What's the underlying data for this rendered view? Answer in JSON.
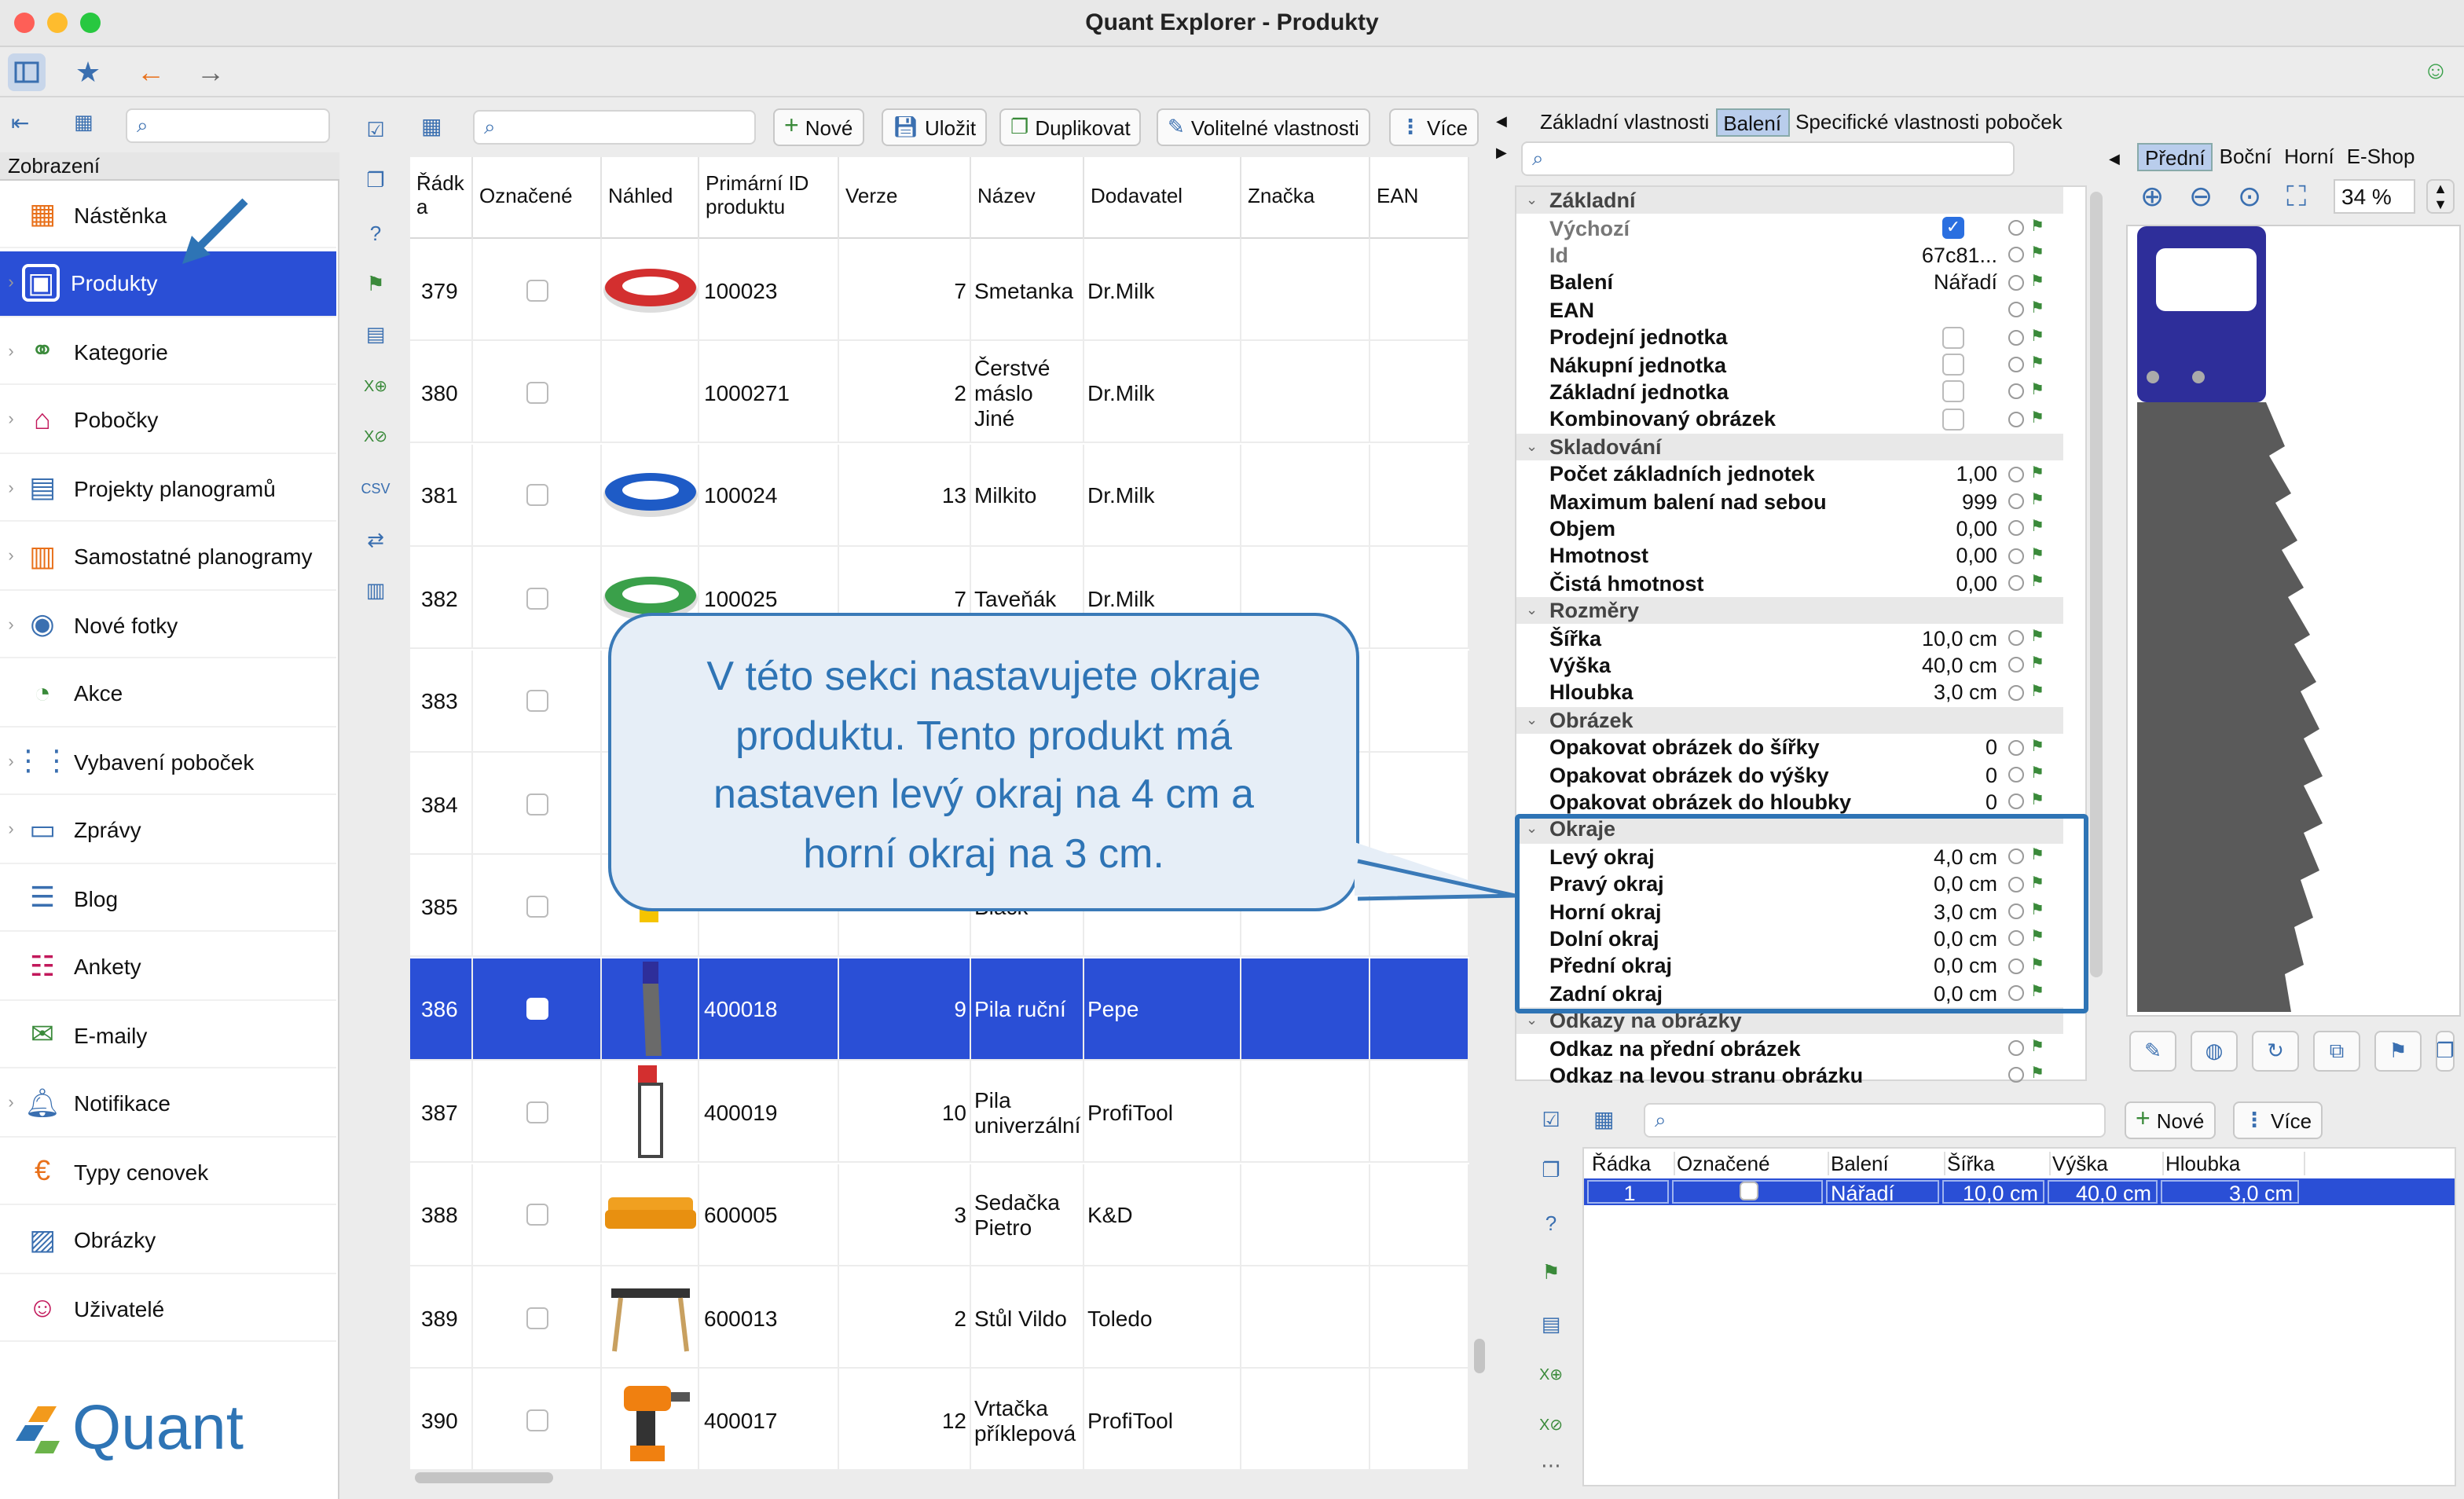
{
  "window": {
    "title": "Quant Explorer - Produkty"
  },
  "sidebar": {
    "section": "Zobrazení",
    "items": [
      {
        "label": "Nástěnka"
      },
      {
        "label": "Produkty"
      },
      {
        "label": "Kategorie"
      },
      {
        "label": "Pobočky"
      },
      {
        "label": "Projekty planogramů"
      },
      {
        "label": "Samostatné planogramy"
      },
      {
        "label": "Nové fotky"
      },
      {
        "label": "Akce"
      },
      {
        "label": "Vybavení poboček"
      },
      {
        "label": "Zprávy"
      },
      {
        "label": "Blog"
      },
      {
        "label": "Ankety"
      },
      {
        "label": "E-maily"
      },
      {
        "label": "Notifikace"
      },
      {
        "label": "Typy cenovek"
      },
      {
        "label": "Obrázky"
      },
      {
        "label": "Uživatelé"
      }
    ],
    "logo": "Quant"
  },
  "toolbar": {
    "new": "Nové",
    "save": "Uložit",
    "duplicate": "Duplikovat",
    "optional": "Volitelné vlastnosti",
    "more": "Více"
  },
  "grid": {
    "headers": [
      "Řádk a",
      "Označené",
      "Náhled",
      "Primární ID produktu",
      "Verze",
      "Název",
      "Dodavatel",
      "Značka",
      "EAN"
    ],
    "rows": [
      {
        "n": "379",
        "id": "100023",
        "ver": "7",
        "name": "Smetanka",
        "sup": "Dr.Milk"
      },
      {
        "n": "380",
        "id": "1000271",
        "ver": "2",
        "name": "Čerstvé máslo Jiné",
        "sup": "Dr.Milk"
      },
      {
        "n": "381",
        "id": "100024",
        "ver": "13",
        "name": "Milkito",
        "sup": "Dr.Milk"
      },
      {
        "n": "382",
        "id": "100025",
        "ver": "7",
        "name": "Taveňák",
        "sup": "Dr.Milk"
      },
      {
        "n": "383",
        "id": "",
        "ver": "",
        "name": "",
        "sup": ""
      },
      {
        "n": "384",
        "id": "",
        "ver": "",
        "name": "",
        "sup": ""
      },
      {
        "n": "385",
        "id": "",
        "ver": "",
        "name": "Black",
        "sup": ""
      },
      {
        "n": "386",
        "id": "400018",
        "ver": "9",
        "name": "Pila ruční",
        "sup": "Pepe"
      },
      {
        "n": "387",
        "id": "400019",
        "ver": "10",
        "name": "Pila univerzální",
        "sup": "ProfiTool"
      },
      {
        "n": "388",
        "id": "600005",
        "ver": "3",
        "name": "Sedačka Pietro",
        "sup": "K&D"
      },
      {
        "n": "389",
        "id": "600013",
        "ver": "2",
        "name": "Stůl Vildo",
        "sup": "Toledo"
      },
      {
        "n": "390",
        "id": "400017",
        "ver": "12",
        "name": "Vrtačka příklepová",
        "sup": "ProfiTool"
      }
    ]
  },
  "callout": {
    "text": "V této sekci nastavujete okraje produktu. Tento produkt má nastaven levý okraj na 4 cm a horní okraj na 3 cm."
  },
  "props": {
    "tabs": [
      "Základní vlastnosti",
      "Balení",
      "Specifické vlastnosti poboček"
    ],
    "rows": [
      {
        "t": "cat",
        "n": "Základní"
      },
      {
        "t": "gray",
        "n": "Výchozí",
        "cb": "on"
      },
      {
        "t": "gray",
        "n": "Id",
        "v": "67c81..."
      },
      {
        "t": "p",
        "n": "Balení",
        "v": "Nářadí"
      },
      {
        "t": "p",
        "n": "EAN",
        "v": ""
      },
      {
        "t": "p",
        "n": "Prodejní jednotka",
        "cb": "off"
      },
      {
        "t": "p",
        "n": "Nákupní jednotka",
        "cb": "off"
      },
      {
        "t": "p",
        "n": "Základní jednotka",
        "cb": "off"
      },
      {
        "t": "p",
        "n": "Kombinovaný obrázek",
        "cb": "off"
      },
      {
        "t": "cat",
        "n": "Skladování"
      },
      {
        "t": "p",
        "n": "Počet základních jednotek",
        "v": "1,00"
      },
      {
        "t": "p",
        "n": "Maximum balení nad sebou",
        "v": "999"
      },
      {
        "t": "p",
        "n": "Objem",
        "v": "0,00"
      },
      {
        "t": "p",
        "n": "Hmotnost",
        "v": "0,00"
      },
      {
        "t": "p",
        "n": "Čistá hmotnost",
        "v": "0,00"
      },
      {
        "t": "cat",
        "n": "Rozměry"
      },
      {
        "t": "p",
        "n": "Šířka",
        "v": "10,0 cm"
      },
      {
        "t": "p",
        "n": "Výška",
        "v": "40,0 cm"
      },
      {
        "t": "p",
        "n": "Hloubka",
        "v": "3,0 cm"
      },
      {
        "t": "cat",
        "n": "Obrázek"
      },
      {
        "t": "p",
        "n": "Opakovat obrázek do šířky",
        "v": "0"
      },
      {
        "t": "p",
        "n": "Opakovat obrázek do výšky",
        "v": "0"
      },
      {
        "t": "p",
        "n": "Opakovat obrázek do hloubky",
        "v": "0"
      },
      {
        "t": "cat",
        "n": "Okraje"
      },
      {
        "t": "p",
        "n": "Levý okraj",
        "v": "4,0 cm"
      },
      {
        "t": "p",
        "n": "Pravý okraj",
        "v": "0,0 cm"
      },
      {
        "t": "p",
        "n": "Horní okraj",
        "v": "3,0 cm"
      },
      {
        "t": "p",
        "n": "Dolní okraj",
        "v": "0,0 cm"
      },
      {
        "t": "p",
        "n": "Přední okraj",
        "v": "0,0 cm"
      },
      {
        "t": "p",
        "n": "Zadní okraj",
        "v": "0,0 cm"
      },
      {
        "t": "cat",
        "n": "Odkazy na obrázky"
      },
      {
        "t": "p",
        "n": "Odkaz na přední obrázek",
        "v": ""
      },
      {
        "t": "p",
        "n": "Odkaz na levou stranu obrázku",
        "v": ""
      }
    ]
  },
  "preview": {
    "tabs": [
      "Přední",
      "Boční",
      "Horní",
      "E-Shop"
    ],
    "zoom": "34 %"
  },
  "packaging": {
    "new": "Nové",
    "more": "Více",
    "headers": [
      "Řádka",
      "Označené",
      "Balení",
      "Šířka",
      "Výška",
      "Hloubka"
    ],
    "row": [
      "1",
      "",
      "Nářadí",
      "10,0 cm",
      "40,0 cm",
      "3,0 cm"
    ]
  },
  "colors": {
    "accent": "#2a4fd6",
    "callout": "#2e74b5"
  }
}
